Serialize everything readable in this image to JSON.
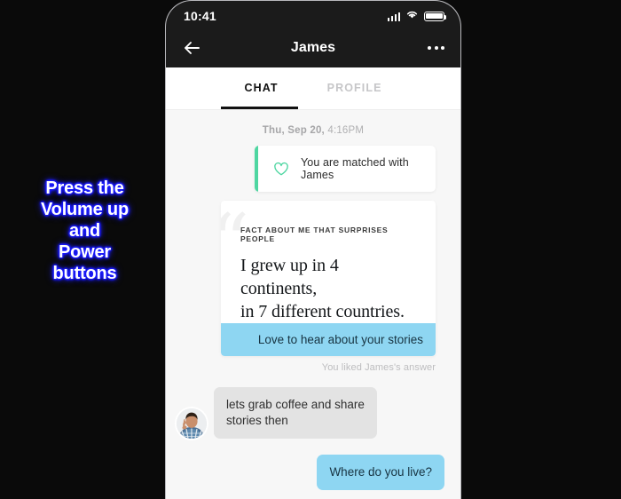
{
  "overlay": {
    "lines": [
      "Press the",
      "Volume up",
      "and",
      "Power",
      "buttons"
    ],
    "color": "#ffffff",
    "glow_color": "#1a1aff"
  },
  "phone": {
    "status_bar": {
      "time": "10:41",
      "icons": [
        "signal-bars-icon",
        "wifi-icon",
        "battery-icon"
      ]
    },
    "nav": {
      "back_icon": "back-arrow-icon",
      "title": "James",
      "overflow_icon": "more-options-icon"
    },
    "tabs": [
      {
        "label": "CHAT",
        "active": true
      },
      {
        "label": "PROFILE",
        "active": false
      }
    ],
    "chat": {
      "date_separator": {
        "date": "Thu, Sep 20,",
        "time": "4:16PM"
      },
      "match_card": {
        "icon": "heart-outline-icon",
        "text": "You are matched with James",
        "accent_color": "#4ed6a1"
      },
      "prompt_card": {
        "quote_glyph": "“",
        "label": "FACT ABOUT ME THAT SURPRISES PEOPLE",
        "answer_line1": "I grew up in 4 continents,",
        "answer_line2": "in 7 different countries.",
        "reply_text": "Love to hear about your stories",
        "reply_color": "#8ed6f2",
        "liked_note": "You liked James's answer"
      },
      "messages": [
        {
          "direction": "incoming",
          "avatar": "james-avatar",
          "line1": "lets grab coffee and share",
          "line2": "stories then",
          "bubble_color": "#e3e3e3"
        },
        {
          "direction": "outgoing",
          "text": "Where do you live?",
          "bubble_color": "#8ed6f2"
        }
      ]
    }
  }
}
